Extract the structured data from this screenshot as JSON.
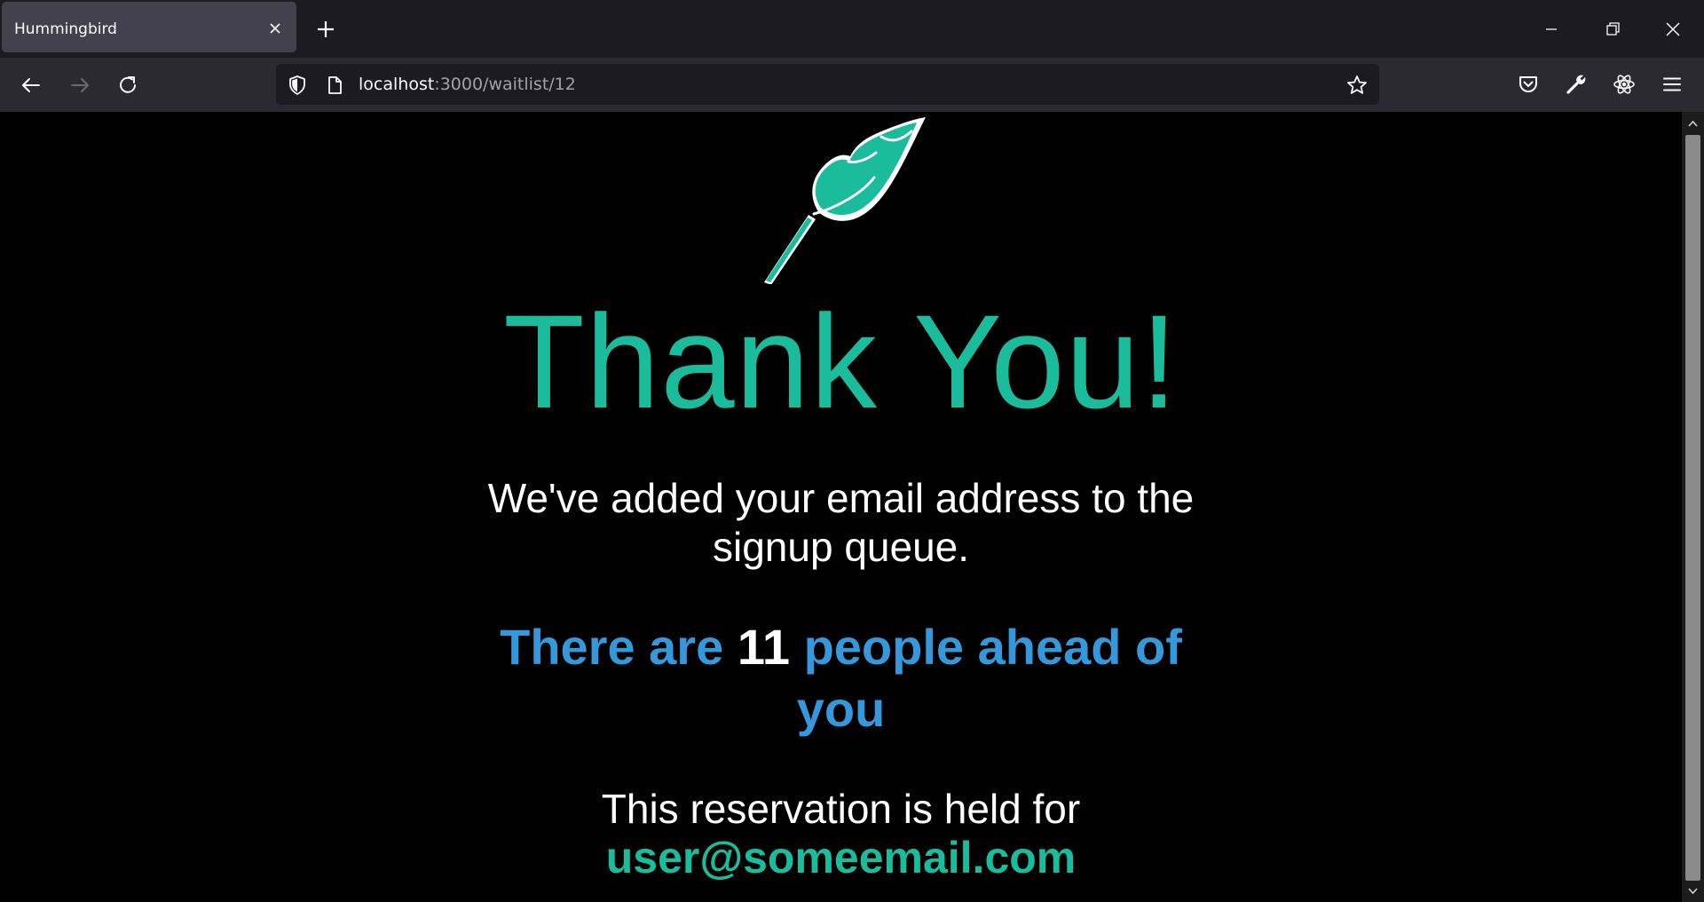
{
  "browser": {
    "tab_title": "Hummingbird",
    "url_host": "localhost",
    "url_path": ":3000/waitlist/12"
  },
  "page": {
    "headline": "Thank You!",
    "confirmation": "We've added your email address to the signup queue.",
    "queue_prefix": "There are",
    "queue_count": "11",
    "queue_suffix": "people ahead of you",
    "reservation_text": "This reservation is held for",
    "email": "user@someemail.com"
  },
  "colors": {
    "accent_teal": "#1abc9c",
    "accent_blue": "#3498db",
    "background": "#000000"
  },
  "icons": {
    "logo": "feather-icon"
  }
}
